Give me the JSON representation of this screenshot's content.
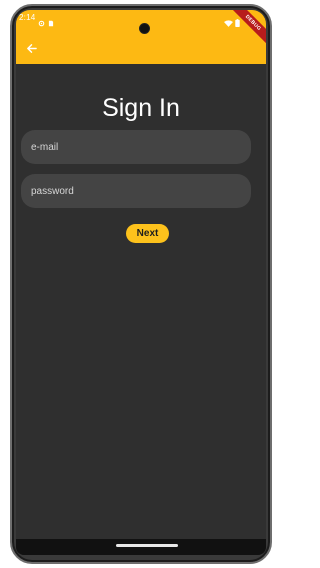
{
  "status_bar": {
    "time": "2:14",
    "icons_left": [
      "settings-icon",
      "sim-card-icon"
    ],
    "icons_right": [
      "wifi-icon",
      "battery-icon"
    ]
  },
  "debug_banner": "DEBUG",
  "app_bar": {
    "back_icon": "arrow-back-icon",
    "color": "#fdb913"
  },
  "page": {
    "title": "Sign In"
  },
  "form": {
    "email_placeholder": "e-mail",
    "password_placeholder": "password",
    "next_label": "Next",
    "button_color": "#fdc21c"
  },
  "theme": {
    "background": "#2f2f2f",
    "field_background": "#444444"
  }
}
